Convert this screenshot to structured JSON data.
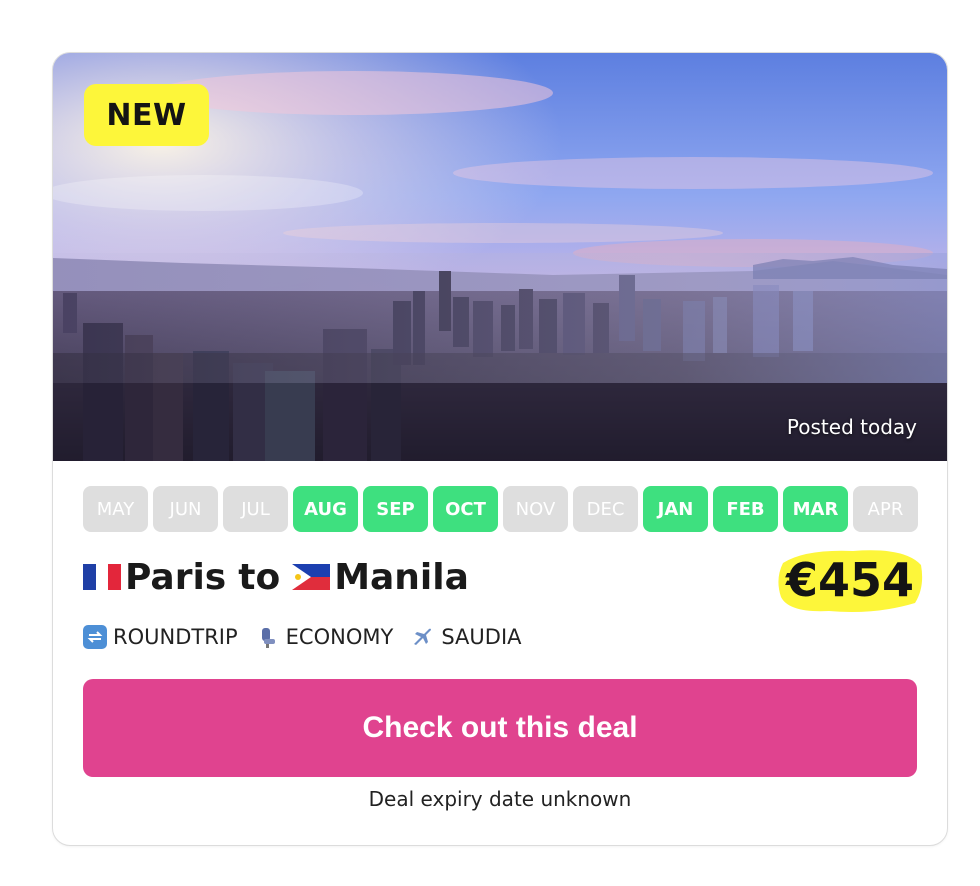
{
  "deal": {
    "badge": "NEW",
    "posted": "Posted today",
    "months": [
      {
        "label": "MAY",
        "active": false
      },
      {
        "label": "JUN",
        "active": false
      },
      {
        "label": "JUL",
        "active": false
      },
      {
        "label": "AUG",
        "active": true
      },
      {
        "label": "SEP",
        "active": true
      },
      {
        "label": "OCT",
        "active": true
      },
      {
        "label": "NOV",
        "active": false
      },
      {
        "label": "DEC",
        "active": false
      },
      {
        "label": "JAN",
        "active": true
      },
      {
        "label": "FEB",
        "active": true
      },
      {
        "label": "MAR",
        "active": true
      },
      {
        "label": "APR",
        "active": false
      }
    ],
    "origin": "Paris",
    "connector": "to",
    "destination": "Manila",
    "origin_flag": "france-flag-icon",
    "destination_flag": "philippines-flag-icon",
    "price": "€454",
    "trip_type": "ROUNDTRIP",
    "cabin": "ECONOMY",
    "airline": "SAUDIA",
    "cta_label": "Check out this deal",
    "expiry": "Deal expiry date unknown"
  },
  "colors": {
    "badge": "#fdf63a",
    "active_month": "#3ee07f",
    "inactive_month": "#dedede",
    "cta": "#e0438f",
    "price_highlight": "#fdf63a"
  }
}
